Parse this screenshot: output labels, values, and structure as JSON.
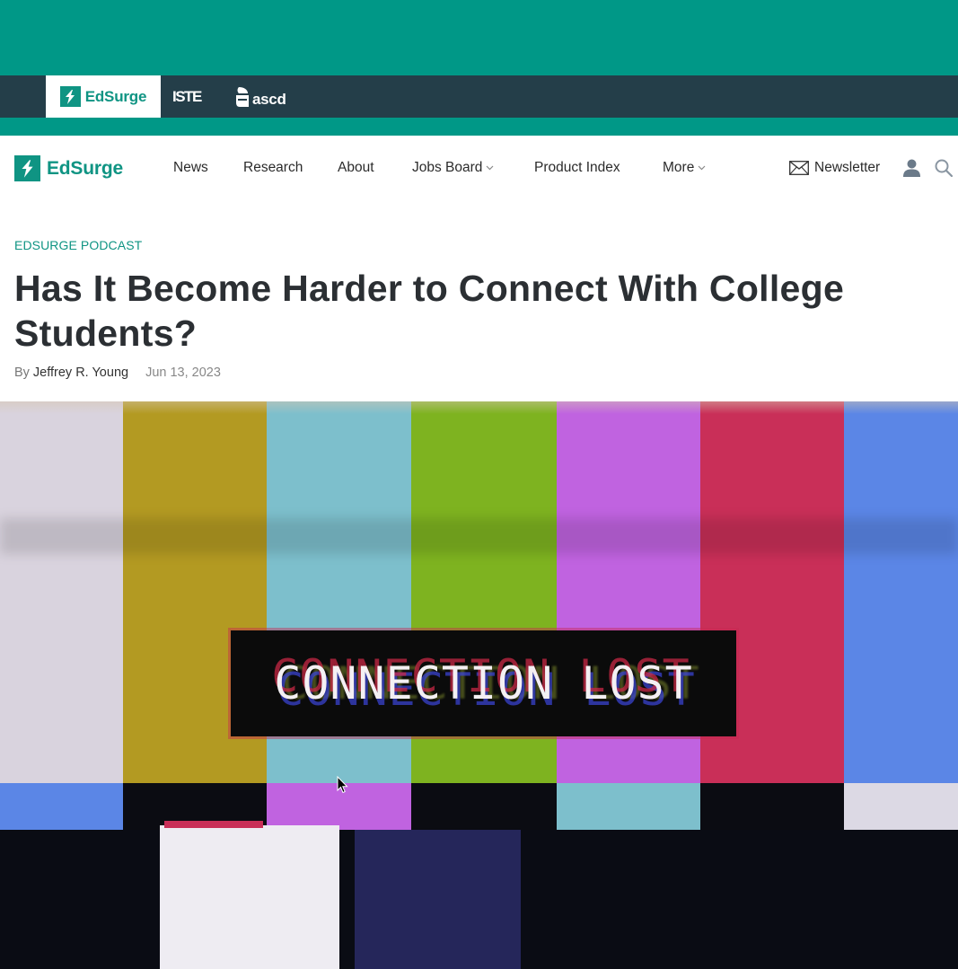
{
  "brand_bar": {
    "tabs": [
      {
        "label": "EdSurge",
        "active": true
      },
      {
        "label": "ISTE",
        "active": false
      },
      {
        "label": "ascd",
        "active": false
      }
    ]
  },
  "nav": {
    "logo_label": "EdSurge",
    "items": [
      {
        "label": "News",
        "has_dropdown": false
      },
      {
        "label": "Research",
        "has_dropdown": false
      },
      {
        "label": "About",
        "has_dropdown": false
      },
      {
        "label": "Jobs Board",
        "has_dropdown": true
      },
      {
        "label": "Product Index",
        "has_dropdown": false
      },
      {
        "label": "More",
        "has_dropdown": true
      }
    ],
    "newsletter_label": "Newsletter",
    "icons": {
      "newsletter": "envelope-icon",
      "account": "user-icon",
      "search": "search-icon"
    }
  },
  "article": {
    "kicker": "EDSURGE PODCAST",
    "title": "Has It Become Harder to Connect With College Students?",
    "byline_prefix": "By",
    "author": "Jeffrey R. Young",
    "date": "Jun 13, 2023"
  },
  "hero_image": {
    "overlay_text": "CONNECTION LOST",
    "top_bars": [
      "#d9d3de",
      "#b39a22",
      "#7dbfcc",
      "#7eb320",
      "#c063e0",
      "#c92f58",
      "#5b86e6"
    ],
    "middle_bars": [
      "#5b86e6",
      "#0b0c12",
      "#c063e0",
      "#0b0c12",
      "#7dbfcc",
      "#0b0c12",
      "#dcd9e4"
    ]
  },
  "colors": {
    "brand_teal": "#009887",
    "brand_dark": "#243e49",
    "logo_teal": "#0f9483",
    "headline": "#2b2f33"
  }
}
